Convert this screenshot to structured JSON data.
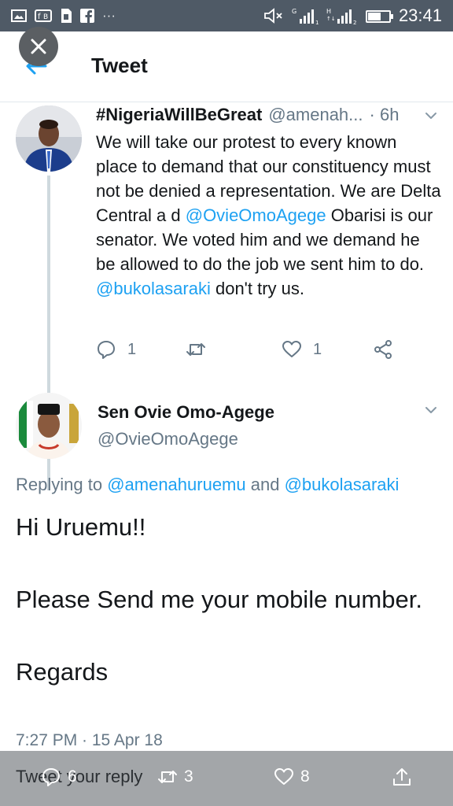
{
  "statusbar": {
    "left_icons": [
      "gallery-icon",
      "fb-lite-icon",
      "sim-icon",
      "facebook-icon",
      "more-icon"
    ],
    "ellipsis": "···",
    "clock": "23:41",
    "battery_level": 0.6
  },
  "header": {
    "title": "Tweet"
  },
  "tweet1": {
    "name": "#NigeriaWillBeGreat",
    "handle": "@amenah...",
    "time": "· 6h",
    "body_1": "We will take our protest to every known place to demand that our constituency must not be denied a representation. We are Delta Central a d ",
    "mention_1": "@OvieOmoAgege",
    "body_2": " Obarisi is our senator. We voted him and we demand he be allowed to do the job we sent him to do. ",
    "mention_2": "@bukolasaraki",
    "body_3": " don't try us.",
    "replies": "1",
    "likes": "1"
  },
  "tweet2": {
    "name": "Sen Ovie Omo-Agege",
    "handle": "@OvieOmoAgege",
    "replying_prefix": "Replying to ",
    "replying_to_1": "@amenahuruemu",
    "replying_and": " and ",
    "replying_to_2": "@bukolasaraki",
    "line_1": "Hi Uruemu!!",
    "line_2": "Please Send me your mobile number.",
    "line_3": "Regards",
    "timestamp": "7:27 PM · 15 Apr 18"
  },
  "bottombar": {
    "reply_placeholder": "Tweet your reply",
    "replies": "6",
    "retweets": "3",
    "likes": "8"
  },
  "colors": {
    "accent": "#1da1f2",
    "status_bar": "#4f5a66",
    "bottom_bar": "#a3a6a9",
    "secondary_text": "#657786"
  }
}
